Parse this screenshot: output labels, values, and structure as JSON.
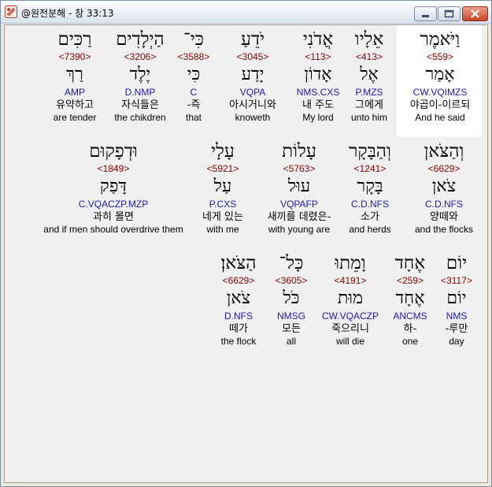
{
  "window": {
    "title": "@원전분해 - 창 33:13",
    "buttons": {
      "minimize": "minimize-icon",
      "maximize": "maximize-icon",
      "close": "close-icon"
    },
    "colors": {
      "strong": "#8b0000",
      "morph": "#1a1ab8",
      "highlight": "#ffffff"
    }
  },
  "rows": [
    {
      "words": [
        {
          "hebrew": "וַיֹּאמֶר",
          "strong": "<559>",
          "lemma": "אָמַר",
          "morph": "CW.VQIMZS",
          "korean": "야곱이-이르되",
          "english": "And he said"
        },
        {
          "hebrew": "אֵלָיו",
          "strong": "<413>",
          "lemma": "אֶל",
          "morph": "P.MZS",
          "korean": "그에게",
          "english": "unto him"
        },
        {
          "hebrew": "אֲדֹנִי",
          "strong": "<113>",
          "lemma": "אָדוֹן",
          "morph": "NMS.CXS",
          "korean": "내 주도",
          "english": "My lord"
        },
        {
          "hebrew": "יֹדֵעַ",
          "strong": "<3045>",
          "lemma": "יָדַע",
          "morph": "VQPA",
          "korean": "아시거니와",
          "english": "knoweth"
        },
        {
          "hebrew": "כִּי־",
          "strong": "<3588>",
          "lemma": "כִּי",
          "morph": "C",
          "korean": "-즉",
          "english": "that"
        },
        {
          "hebrew": "הַיְלָדִים",
          "strong": "<3206>",
          "lemma": "יֶלֶד",
          "morph": "D.NMP",
          "korean": "자식들은",
          "english": "the chikdren"
        },
        {
          "hebrew": "רַכִּים",
          "strong": "<7390>",
          "lemma": "רַךְ",
          "morph": "AMP",
          "korean": "유약하고",
          "english": "are tender"
        }
      ]
    },
    {
      "words": [
        {
          "hebrew": "וְהַצֹּאן",
          "strong": "<6629>",
          "lemma": "צֹאן",
          "morph": "C.D.NFS",
          "korean": "양떼와",
          "english": "and the flocks"
        },
        {
          "hebrew": "וְהַבָּקָר",
          "strong": "<1241>",
          "lemma": "בָּקָר",
          "morph": "C.D.NFS",
          "korean": "소가",
          "english": "and herds"
        },
        {
          "hebrew": "עָלוֹת",
          "strong": "<5763>",
          "lemma": "עוּל",
          "morph": "VQPAFP",
          "korean": "새끼를 데렸은-",
          "english": "with young are"
        },
        {
          "hebrew": "עָלָי",
          "strong": "<5921>",
          "lemma": "עַל",
          "morph": "P.CXS",
          "korean": "네게 있는",
          "english": "with me"
        },
        {
          "hebrew": "וּדְפָקוּם",
          "strong": "<1849>",
          "lemma": "דָּפַק",
          "morph": "C.VQACZP.MZP",
          "korean": "과히 몰면",
          "english": "and if men should overdrive them"
        }
      ]
    },
    {
      "words": [
        {
          "hebrew": "יוֹם",
          "strong": "<3117>",
          "lemma": "יוֹם",
          "morph": "NMS",
          "korean": "-루만",
          "english": "day"
        },
        {
          "hebrew": "אֶחָד",
          "strong": "<259>",
          "lemma": "אֶחָד",
          "morph": "ANCMS",
          "korean": "하-",
          "english": "one"
        },
        {
          "hebrew": "וָמֵתוּ",
          "strong": "<4191>",
          "lemma": "מוּת",
          "morph": "CW.VQACZP",
          "korean": "죽으리니",
          "english": "will die"
        },
        {
          "hebrew": "כָּל־",
          "strong": "<3605>",
          "lemma": "כֹּל",
          "morph": "NMSG",
          "korean": "모든",
          "english": "all"
        },
        {
          "hebrew": "הַצֹּאן׃",
          "strong": "<6629>",
          "lemma": "צֹאן",
          "morph": "D.NFS",
          "korean": "떼가",
          "english": "the flock"
        }
      ]
    }
  ]
}
